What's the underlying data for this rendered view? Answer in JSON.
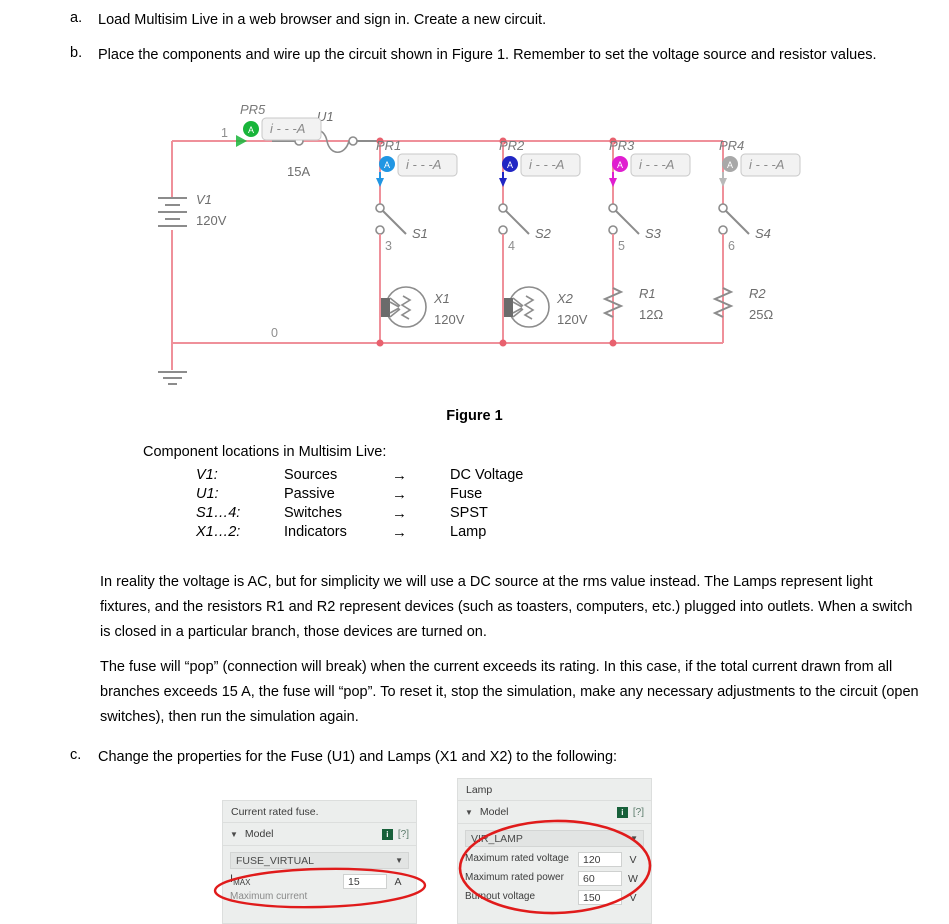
{
  "steps": [
    {
      "marker": "a.",
      "text": "Load Multisim Live in a web browser and sign in. Create a new circuit."
    },
    {
      "marker": "b.",
      "text": "Place the components and wire up the circuit shown in Figure 1. Remember to set the voltage source and resistor values."
    },
    {
      "marker": "c.",
      "text": "Change the properties for the Fuse (U1) and Lamps (X1 and X2) to the following:"
    }
  ],
  "figure": {
    "caption": "Figure 1",
    "source": {
      "ref": "V1",
      "value": "120V"
    },
    "fuse": {
      "ref": "U1",
      "rating": "15A"
    },
    "probes": [
      {
        "ref": "PR5",
        "reading": "i - - - A",
        "color": "#18b53a"
      },
      {
        "ref": "PR1",
        "reading": "i - - - A",
        "color": "#2196e3"
      },
      {
        "ref": "PR2",
        "reading": "i - - - A",
        "color": "#2126c4"
      },
      {
        "ref": "PR3",
        "reading": "i - - - A",
        "color": "#e01ed0"
      },
      {
        "ref": "PR4",
        "reading": "i - - - A",
        "color": "#a8a8a8"
      }
    ],
    "switches": [
      {
        "ref": "S1"
      },
      {
        "ref": "S2"
      },
      {
        "ref": "S3"
      },
      {
        "ref": "S4"
      }
    ],
    "loads": [
      {
        "ref": "X1",
        "value": "120V",
        "type": "lamp"
      },
      {
        "ref": "X2",
        "value": "120V",
        "type": "lamp"
      },
      {
        "ref": "R1",
        "value": "12Ω",
        "type": "resistor"
      },
      {
        "ref": "R2",
        "value": "25Ω",
        "type": "resistor"
      }
    ],
    "nodes": [
      "1",
      "0",
      "3",
      "4",
      "5",
      "6"
    ],
    "wire_color": "#ef909a",
    "lead_color": "#8c8c8c"
  },
  "components_table": {
    "heading": "Component locations in Multisim Live:",
    "arrow": "→",
    "rows": [
      {
        "ref": "V1:",
        "category": "Sources",
        "item": "DC Voltage"
      },
      {
        "ref": "U1:",
        "category": "Passive",
        "item": "Fuse"
      },
      {
        "ref": "S1…4:",
        "category": "Switches",
        "item": "SPST"
      },
      {
        "ref": "X1…2:",
        "category": "Indicators",
        "item": "Lamp"
      }
    ]
  },
  "paragraphs": [
    "In reality the voltage is AC, but for simplicity we will use a DC source at the rms value instead. The Lamps represent light fixtures, and the resistors R1 and R2 represent devices (such as toasters, computers, etc.) plugged into outlets. When a switch is closed in a particular branch, those devices are turned on.",
    "The fuse will “pop” (connection will break) when the current exceeds its rating. In this case, if the total current drawn from all branches exceeds 15 A, the fuse will “pop”. To reset it, stop the simulation, make any necessary adjustments to the circuit (open switches), then run the simulation again."
  ],
  "fuse_panel": {
    "title": "Current rated fuse.",
    "model_label": "Model",
    "info_badge": "i",
    "help": "[?]",
    "model_value": "FUSE_VIRTUAL",
    "property_label": "I",
    "property_sub": "MAX",
    "property_value": "15",
    "property_unit": "A",
    "property_note": "Maximum current"
  },
  "lamp_panel": {
    "title": "Lamp",
    "model_label": "Model",
    "info_badge": "i",
    "help": "[?]",
    "model_value": "VIR_LAMP",
    "rows": [
      {
        "name": "Maximum rated voltage",
        "value": "120",
        "unit": "V"
      },
      {
        "name": "Maximum rated power",
        "value": "60",
        "unit": "W"
      },
      {
        "name": "Burnout voltage",
        "value": "150",
        "unit": "V"
      }
    ]
  },
  "annotation_color": "#e01b1b"
}
